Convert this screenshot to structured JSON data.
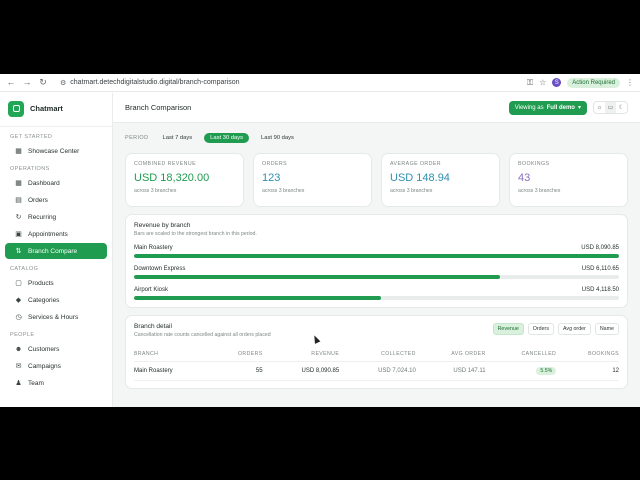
{
  "browser": {
    "url": "chatmart.detechdigitalstudio.digital/branch-comparison",
    "profile_initial": "S",
    "action_required": "Action Required"
  },
  "brand": {
    "name": "Chatmart",
    "accent": "#1f9c4f"
  },
  "sidebar": {
    "sections": [
      {
        "label": "GET STARTED",
        "items": [
          {
            "label": "Showcase Center",
            "icon": "grid-icon"
          }
        ]
      },
      {
        "label": "OPERATIONS",
        "items": [
          {
            "label": "Dashboard",
            "icon": "grid-icon"
          },
          {
            "label": "Orders",
            "icon": "document-icon"
          },
          {
            "label": "Recurring",
            "icon": "repeat-icon"
          },
          {
            "label": "Appointments",
            "icon": "calendar-icon"
          },
          {
            "label": "Branch Compare",
            "icon": "compare-icon",
            "active": true
          }
        ]
      },
      {
        "label": "CATALOG",
        "items": [
          {
            "label": "Products",
            "icon": "box-icon"
          },
          {
            "label": "Categories",
            "icon": "tag-icon"
          },
          {
            "label": "Services & Hours",
            "icon": "clock-icon"
          }
        ]
      },
      {
        "label": "PEOPLE",
        "items": [
          {
            "label": "Customers",
            "icon": "users-icon"
          },
          {
            "label": "Campaigns",
            "icon": "megaphone-icon"
          },
          {
            "label": "Team",
            "icon": "team-icon"
          }
        ]
      }
    ]
  },
  "header": {
    "title": "Branch Comparison",
    "viewing_prefix": "Viewing as",
    "viewing_value": "Full demo"
  },
  "period": {
    "label": "PERIOD",
    "options": [
      "Last 7 days",
      "Last 30 days",
      "Last 90 days"
    ],
    "selected": "Last 30 days"
  },
  "kpis": [
    {
      "label": "COMBINED REVENUE",
      "value": "USD 18,320.00",
      "sub": "across 3 branches",
      "color": "#1f9c4f"
    },
    {
      "label": "ORDERS",
      "value": "123",
      "sub": "across 3 branches",
      "color": "#2f8fb0"
    },
    {
      "label": "AVERAGE ORDER",
      "value": "USD 148.94",
      "sub": "across 3 branches",
      "color": "#2f8fb0"
    },
    {
      "label": "BOOKINGS",
      "value": "43",
      "sub": "across 3 branches",
      "color": "#8a6fc4"
    }
  ],
  "revenue_card": {
    "title": "Revenue by branch",
    "subtitle": "Bars are scaled to the strongest branch in this period.",
    "rows": [
      {
        "name": "Main Roastery",
        "value": "USD 8,090.85",
        "fraction": 1.0
      },
      {
        "name": "Downtown Express",
        "value": "USD 6,110.65",
        "fraction": 0.755
      },
      {
        "name": "Airport Kiosk",
        "value": "USD 4,118.50",
        "fraction": 0.509
      }
    ]
  },
  "detail_card": {
    "title": "Branch detail",
    "subtitle": "Cancellation rate counts cancelled against all orders placed",
    "sort_buttons": [
      "Revenue",
      "Orders",
      "Avg order",
      "Name"
    ],
    "sort_selected": "Revenue",
    "columns": [
      "BRANCH",
      "ORDERS",
      "REVENUE",
      "COLLECTED",
      "AVG ORDER",
      "CANCELLED",
      "BOOKINGS"
    ],
    "rows": [
      {
        "branch": "Main Roastery",
        "orders": "55",
        "revenue": "USD 8,090.85",
        "collected": "USD 7,024.10",
        "avg": "USD 147.11",
        "cancelled": "5.5%",
        "bookings": "12"
      }
    ]
  }
}
